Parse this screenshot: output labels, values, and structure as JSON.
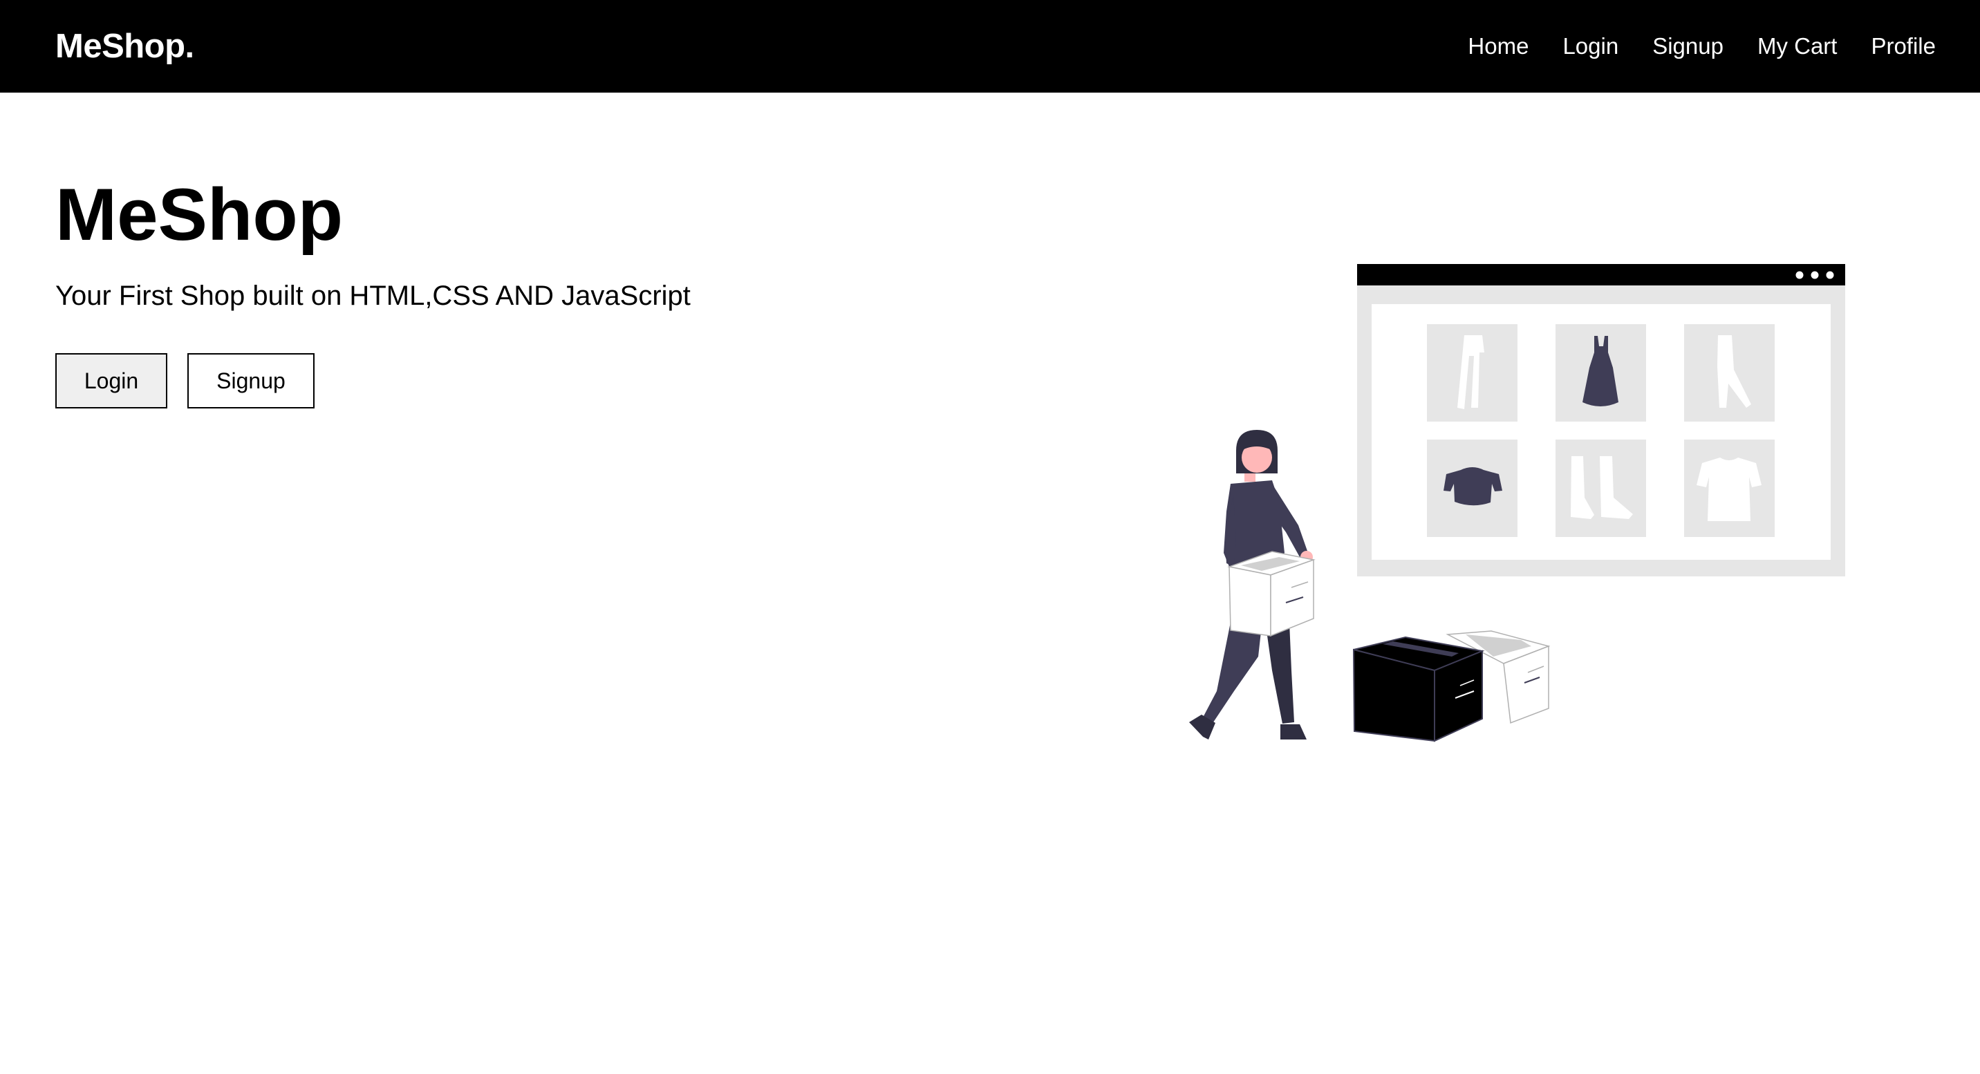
{
  "navbar": {
    "brand": "MeShop.",
    "links": [
      "Home",
      "Login",
      "Signup",
      "My Cart",
      "Profile"
    ]
  },
  "hero": {
    "title": "MeShop",
    "subtitle": "Your First Shop built on HTML,CSS AND JavaScript",
    "login_label": "Login",
    "signup_label": "Signup"
  },
  "illustration": {
    "name": "online-shopping-illustration",
    "colors": {
      "dark": "#3f3d56",
      "black": "#000000",
      "light_gray": "#e6e6e6",
      "skin": "#ffb8b8"
    }
  }
}
